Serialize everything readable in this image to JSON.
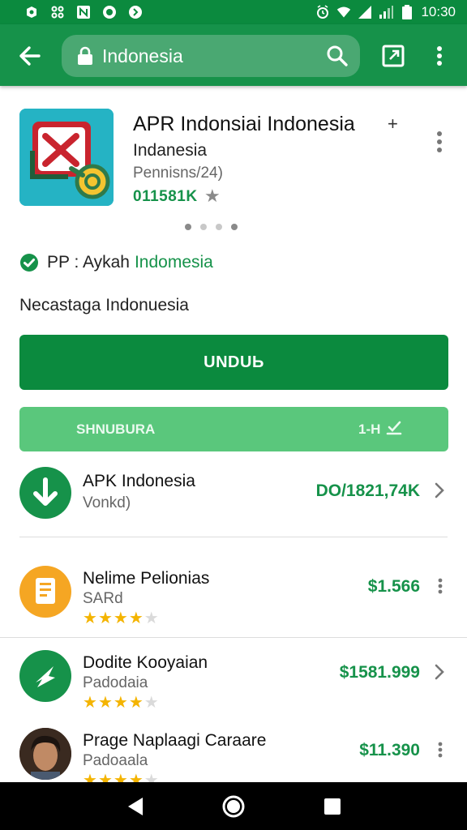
{
  "status_bar": {
    "time": "10:30",
    "left_icons": [
      "notification-icon",
      "usb-icon",
      "app-icon",
      "camera-icon",
      "shazam-icon"
    ],
    "right_icons": [
      "alarm-icon",
      "wifi-icon",
      "signal-icon",
      "signal-weak-icon",
      "battery-icon"
    ]
  },
  "toolbar": {
    "search_text": "Indonesia"
  },
  "app": {
    "title": "APR Indonsiai Indonesia",
    "plus": "+",
    "developer": "Indanesia",
    "version": "Pennisns/24)",
    "downloads": "011581K",
    "star": "★",
    "verified_prefix": "PP : Aykah",
    "verified_link": "Indomesia",
    "subtitle": "Necastaga Indonuesia"
  },
  "buttons": {
    "primary": "UNDUЬ",
    "secondary_left": "SНNUBURA",
    "secondary_right": "1-H"
  },
  "list": [
    {
      "title": "APK Indonesia",
      "subtitle": "Vonkd)",
      "price": "DO/1821,74K",
      "action": "chevron",
      "rating": null,
      "icon": "download-icon",
      "color": "#16924a"
    },
    {
      "title": "Nelime Pelionias",
      "subtitle": "SARd",
      "price": "$1.566",
      "action": "more",
      "rating": 4,
      "icon": "document-icon",
      "color": "#f5a623"
    },
    {
      "title": "Dodite Kooyaian",
      "subtitle": "Padodaia",
      "price": "$1581.999",
      "action": "chevron",
      "rating": 4,
      "icon": "navigation-icon",
      "color": "#16924a"
    },
    {
      "title": "Prage Naplaagi Caraare",
      "subtitle": "Padoaala",
      "price": "$11.390",
      "action": "more",
      "rating": 4,
      "icon": "avatar",
      "color": "#5b3a2a"
    }
  ],
  "colors": {
    "brand_green": "#16924a",
    "status_bar": "#0b8a3e",
    "secondary_button": "#5ac77c",
    "star": "#f4b400"
  }
}
